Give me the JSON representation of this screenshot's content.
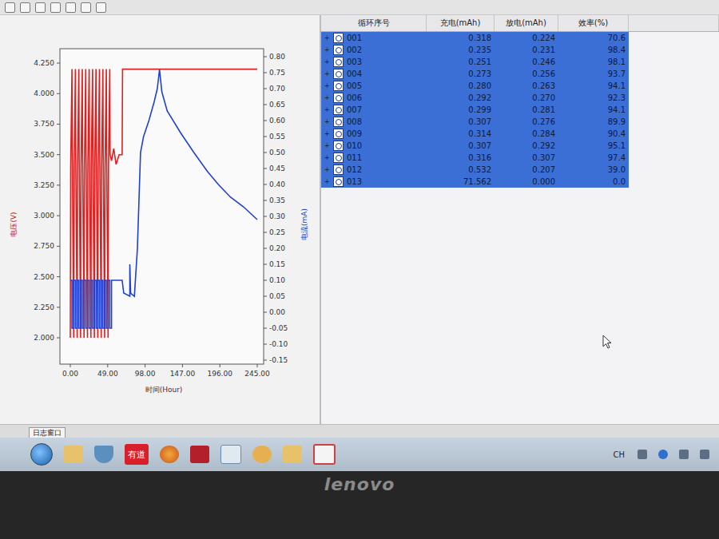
{
  "chart": {
    "left_axis": {
      "title": "电压(V)",
      "ticks": [
        "4.250",
        "4.000",
        "3.750",
        "3.500",
        "3.250",
        "3.000",
        "2.750",
        "2.500",
        "2.250",
        "2.000"
      ]
    },
    "right_axis": {
      "title": "电流(mA)",
      "ticks": [
        "0.80",
        "0.75",
        "0.70",
        "0.65",
        "0.60",
        "0.55",
        "0.50",
        "0.45",
        "0.40",
        "0.35",
        "0.30",
        "0.25",
        "0.20",
        "0.15",
        "0.10",
        "0.05",
        "0.00",
        "-0.05",
        "-0.10",
        "-0.15"
      ]
    },
    "x_axis": {
      "title": "时间(Hour)",
      "ticks": [
        "0.00",
        "49.00",
        "98.00",
        "147.00",
        "196.00",
        "245.00"
      ]
    },
    "series": [
      {
        "name": "电压",
        "axis": "left",
        "color": "#e02020",
        "t": [
          0,
          0.5,
          2.2,
          2.6,
          4.5,
          5,
          6.7,
          7.1,
          9,
          9.5,
          11.2,
          11.6,
          13.5,
          14,
          15.7,
          16.1,
          18,
          18.5,
          20.2,
          20.6,
          22.5,
          23,
          24.7,
          25.1,
          27,
          27.5,
          29.2,
          29.6,
          31.5,
          32,
          33.7,
          34.1,
          36,
          36.5,
          38.2,
          38.6,
          40.5,
          41,
          42.7,
          43.1,
          45,
          45.5,
          47.2,
          47.6,
          49.5,
          50,
          51.7,
          52.1,
          54,
          57,
          60,
          64,
          68,
          68.5,
          245
        ],
        "values": [
          2.0,
          3.4,
          4.2,
          3.5,
          2.0,
          3.4,
          4.2,
          3.5,
          2.0,
          3.4,
          4.2,
          3.5,
          2.0,
          3.4,
          4.2,
          3.5,
          2.0,
          3.4,
          4.2,
          3.5,
          2.0,
          3.4,
          4.2,
          3.5,
          2.0,
          3.4,
          4.2,
          3.5,
          2.0,
          3.4,
          4.2,
          3.5,
          2.0,
          3.4,
          4.2,
          3.5,
          2.0,
          3.4,
          4.2,
          3.5,
          2.0,
          3.4,
          4.2,
          3.5,
          2.0,
          3.4,
          4.2,
          3.5,
          3.45,
          3.55,
          3.42,
          3.5,
          3.5,
          4.2,
          4.2
        ]
      },
      {
        "name": "电流",
        "axis": "right",
        "color": "#2040d0",
        "t": [
          0,
          2.2,
          2.2,
          4.5,
          4.5,
          6.7,
          6.7,
          9,
          9,
          11.2,
          11.2,
          13.5,
          13.5,
          15.7,
          15.7,
          18,
          18,
          20.2,
          20.2,
          22.5,
          22.5,
          24.7,
          24.7,
          27,
          27,
          29.2,
          29.2,
          31.5,
          31.5,
          33.7,
          33.7,
          36,
          36,
          38.2,
          38.2,
          40.5,
          40.5,
          42.7,
          42.7,
          45,
          45,
          47.2,
          47.2,
          49.5,
          49.5,
          51.7,
          51.7,
          54,
          54,
          68,
          70,
          78,
          78,
          79,
          84,
          88,
          92,
          96,
          103,
          110,
          114,
          117,
          120,
          127,
          145,
          162,
          180,
          194,
          210,
          227,
          245
        ],
        "values": [
          0.1,
          0.1,
          -0.05,
          -0.05,
          0.1,
          0.1,
          -0.05,
          -0.05,
          0.1,
          0.1,
          -0.05,
          -0.05,
          0.1,
          0.1,
          -0.05,
          -0.05,
          0.1,
          0.1,
          -0.05,
          -0.05,
          0.1,
          0.1,
          -0.05,
          -0.05,
          0.1,
          0.1,
          -0.05,
          -0.05,
          0.1,
          0.1,
          -0.05,
          -0.05,
          0.1,
          0.1,
          -0.05,
          -0.05,
          0.1,
          0.1,
          -0.05,
          -0.05,
          0.1,
          0.1,
          -0.05,
          -0.05,
          0.1,
          0.1,
          -0.05,
          -0.05,
          0.1,
          0.1,
          0.06,
          0.05,
          0.15,
          0.06,
          0.05,
          0.2,
          0.5,
          0.55,
          0.6,
          0.66,
          0.7,
          0.76,
          0.69,
          0.63,
          0.56,
          0.5,
          0.44,
          0.4,
          0.36,
          0.33,
          0.29
        ]
      }
    ]
  },
  "table": {
    "columns": [
      "循环序号",
      "充电(mAh)",
      "放电(mAh)",
      "效率(%)"
    ],
    "rows": [
      {
        "expander": "+",
        "id": "001",
        "charge": "0.318",
        "discharge": "0.224",
        "efficiency": "70.6",
        "selected": true
      },
      {
        "expander": "+",
        "id": "002",
        "charge": "0.235",
        "discharge": "0.231",
        "efficiency": "98.4",
        "selected": true
      },
      {
        "expander": "+",
        "id": "003",
        "charge": "0.251",
        "discharge": "0.246",
        "efficiency": "98.1",
        "selected": true
      },
      {
        "expander": "+",
        "id": "004",
        "charge": "0.273",
        "discharge": "0.256",
        "efficiency": "93.7",
        "selected": true
      },
      {
        "expander": "+",
        "id": "005",
        "charge": "0.280",
        "discharge": "0.263",
        "efficiency": "94.1",
        "selected": true
      },
      {
        "expander": "+",
        "id": "006",
        "charge": "0.292",
        "discharge": "0.270",
        "efficiency": "92.3",
        "selected": true
      },
      {
        "expander": "+",
        "id": "007",
        "charge": "0.299",
        "discharge": "0.281",
        "efficiency": "94.1",
        "selected": true
      },
      {
        "expander": "+",
        "id": "008",
        "charge": "0.307",
        "discharge": "0.276",
        "efficiency": "89.9",
        "selected": true
      },
      {
        "expander": "+",
        "id": "009",
        "charge": "0.314",
        "discharge": "0.284",
        "efficiency": "90.4",
        "selected": true
      },
      {
        "expander": "+",
        "id": "010",
        "charge": "0.307",
        "discharge": "0.292",
        "efficiency": "95.1",
        "selected": true
      },
      {
        "expander": "+",
        "id": "011",
        "charge": "0.316",
        "discharge": "0.307",
        "efficiency": "97.4",
        "selected": true
      },
      {
        "expander": "+",
        "id": "012",
        "charge": "0.532",
        "discharge": "0.207",
        "efficiency": "39.0",
        "selected": true
      },
      {
        "expander": "+",
        "id": "013",
        "charge": "71.562",
        "discharge": "0.000",
        "efficiency": "0.0",
        "selected": true
      }
    ]
  },
  "log_tab": "日志窗口",
  "taskbar": {
    "youdao_label": "有道",
    "language": "CH"
  },
  "device": {
    "brand": "lenovo"
  }
}
